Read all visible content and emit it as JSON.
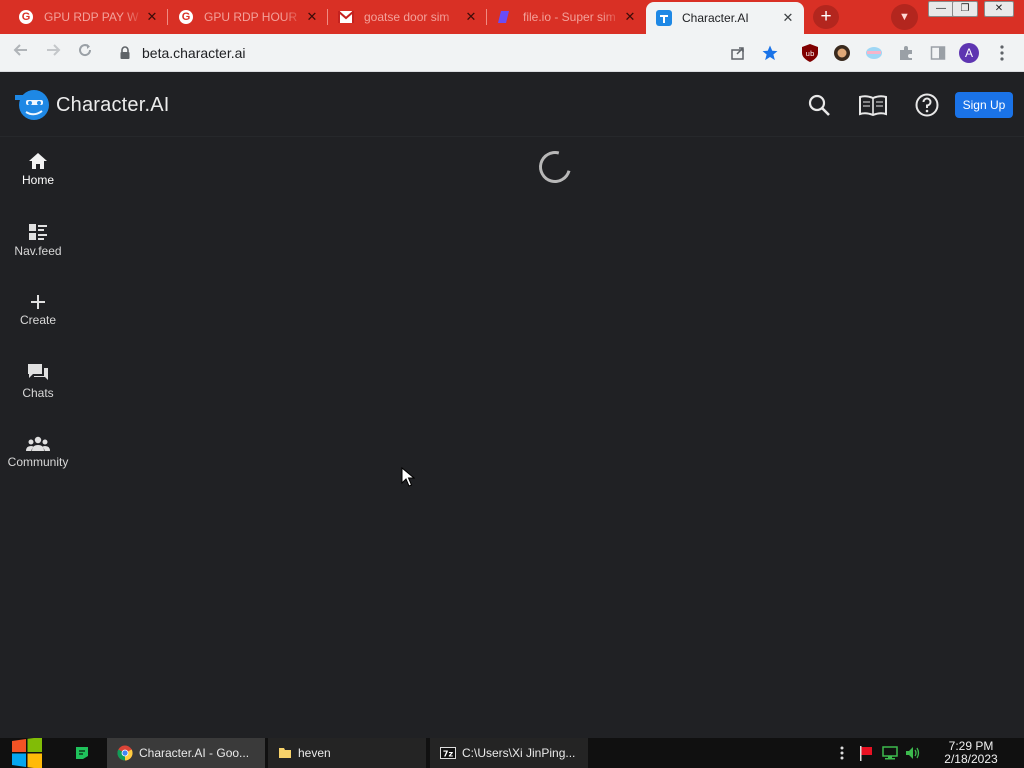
{
  "browser": {
    "tabs": [
      {
        "title": "GPU RDP PAY W",
        "favicon": "google-g-icon",
        "active": false
      },
      {
        "title": "GPU RDP HOUR",
        "favicon": "google-g-icon",
        "active": false
      },
      {
        "title": "goatse door sim",
        "favicon": "gmail-icon",
        "active": false
      },
      {
        "title": "file.io - Super sim",
        "favicon": "fileio-icon",
        "active": false
      },
      {
        "title": "Character.AI",
        "favicon": "characterai-icon",
        "active": true
      }
    ],
    "url": "beta.character.ai",
    "new_tab_label": "+",
    "window_controls": [
      "—",
      "❐",
      "✕"
    ]
  },
  "app": {
    "brand": "Character.AI",
    "signup_label": "Sign Up",
    "header_icons": [
      "search-icon",
      "book-icon",
      "help-icon"
    ],
    "nav": [
      {
        "label": "Home",
        "icon": "home-icon",
        "selected": true
      },
      {
        "label": "Nav.feed",
        "icon": "feed-icon",
        "selected": false
      },
      {
        "label": "Create",
        "icon": "plus-icon",
        "selected": false
      },
      {
        "label": "Chats",
        "icon": "chats-icon",
        "selected": false
      },
      {
        "label": "Community",
        "icon": "community-icon",
        "selected": false
      }
    ],
    "loading": true
  },
  "taskbar": {
    "items": [
      {
        "label": "Character.AI - Goo...",
        "icon": "chrome-icon",
        "active": true
      },
      {
        "label": "heven",
        "icon": "folder-icon",
        "active": false
      },
      {
        "label": "C:\\Users\\Xi JinPing...",
        "icon": "7zip-icon",
        "active": false
      }
    ],
    "time": "7:29 PM",
    "date": "2/18/2023"
  },
  "colors": {
    "tabstrip": "#d93025",
    "page_bg": "#202124",
    "signup_bg": "#1a73e8",
    "brand_blue": "#1e88e5",
    "taskbar": "#101010"
  }
}
